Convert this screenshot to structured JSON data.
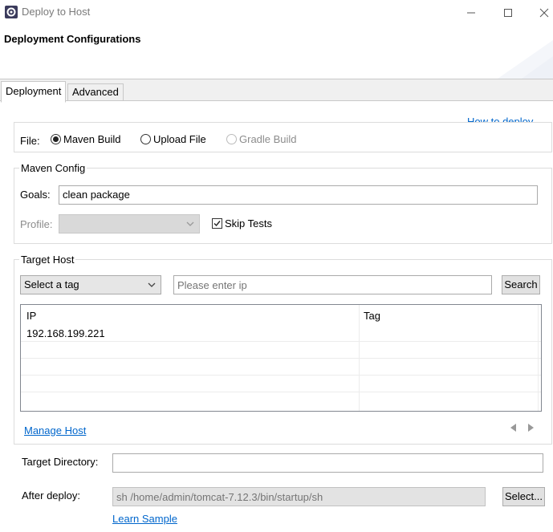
{
  "window": {
    "title": "Deploy to Host"
  },
  "banner": {
    "title": "Deployment Configurations"
  },
  "tabs": [
    {
      "label": "Deployment",
      "active": true
    },
    {
      "label": "Advanced",
      "active": false
    }
  ],
  "help": {
    "how_to_deploy": "How to deploy..."
  },
  "file": {
    "label": "File:",
    "options": [
      {
        "label": "Maven Build",
        "selected": true,
        "enabled": true
      },
      {
        "label": "Upload File",
        "selected": false,
        "enabled": true
      },
      {
        "label": "Gradle Build",
        "selected": false,
        "enabled": false
      }
    ]
  },
  "maven": {
    "legend": "Maven Config",
    "goals_label": "Goals:",
    "goals_value": "clean package",
    "profile_label": "Profile:",
    "profile_value": "",
    "skip_tests_label": "Skip Tests",
    "skip_tests_checked": true
  },
  "target_host": {
    "legend": "Target Host",
    "tag_select": "Select a tag",
    "ip_placeholder": "Please enter ip",
    "search_label": "Search",
    "columns": [
      "IP",
      "Tag"
    ],
    "rows": [
      {
        "ip": "192.168.199.221",
        "tag": ""
      }
    ],
    "manage_host": "Manage Host"
  },
  "target_directory": {
    "label": "Target Directory:",
    "value": ""
  },
  "after_deploy": {
    "label": "After deploy:",
    "placeholder": "sh /home/admin/tomcat-7.12.3/bin/startup/sh",
    "select_label": "Select...",
    "learn_sample": "Learn Sample"
  },
  "colors": {
    "link": "#0066cc",
    "selected_tab_bg": "#ffffff",
    "window_bg": "#f0f0f0"
  }
}
